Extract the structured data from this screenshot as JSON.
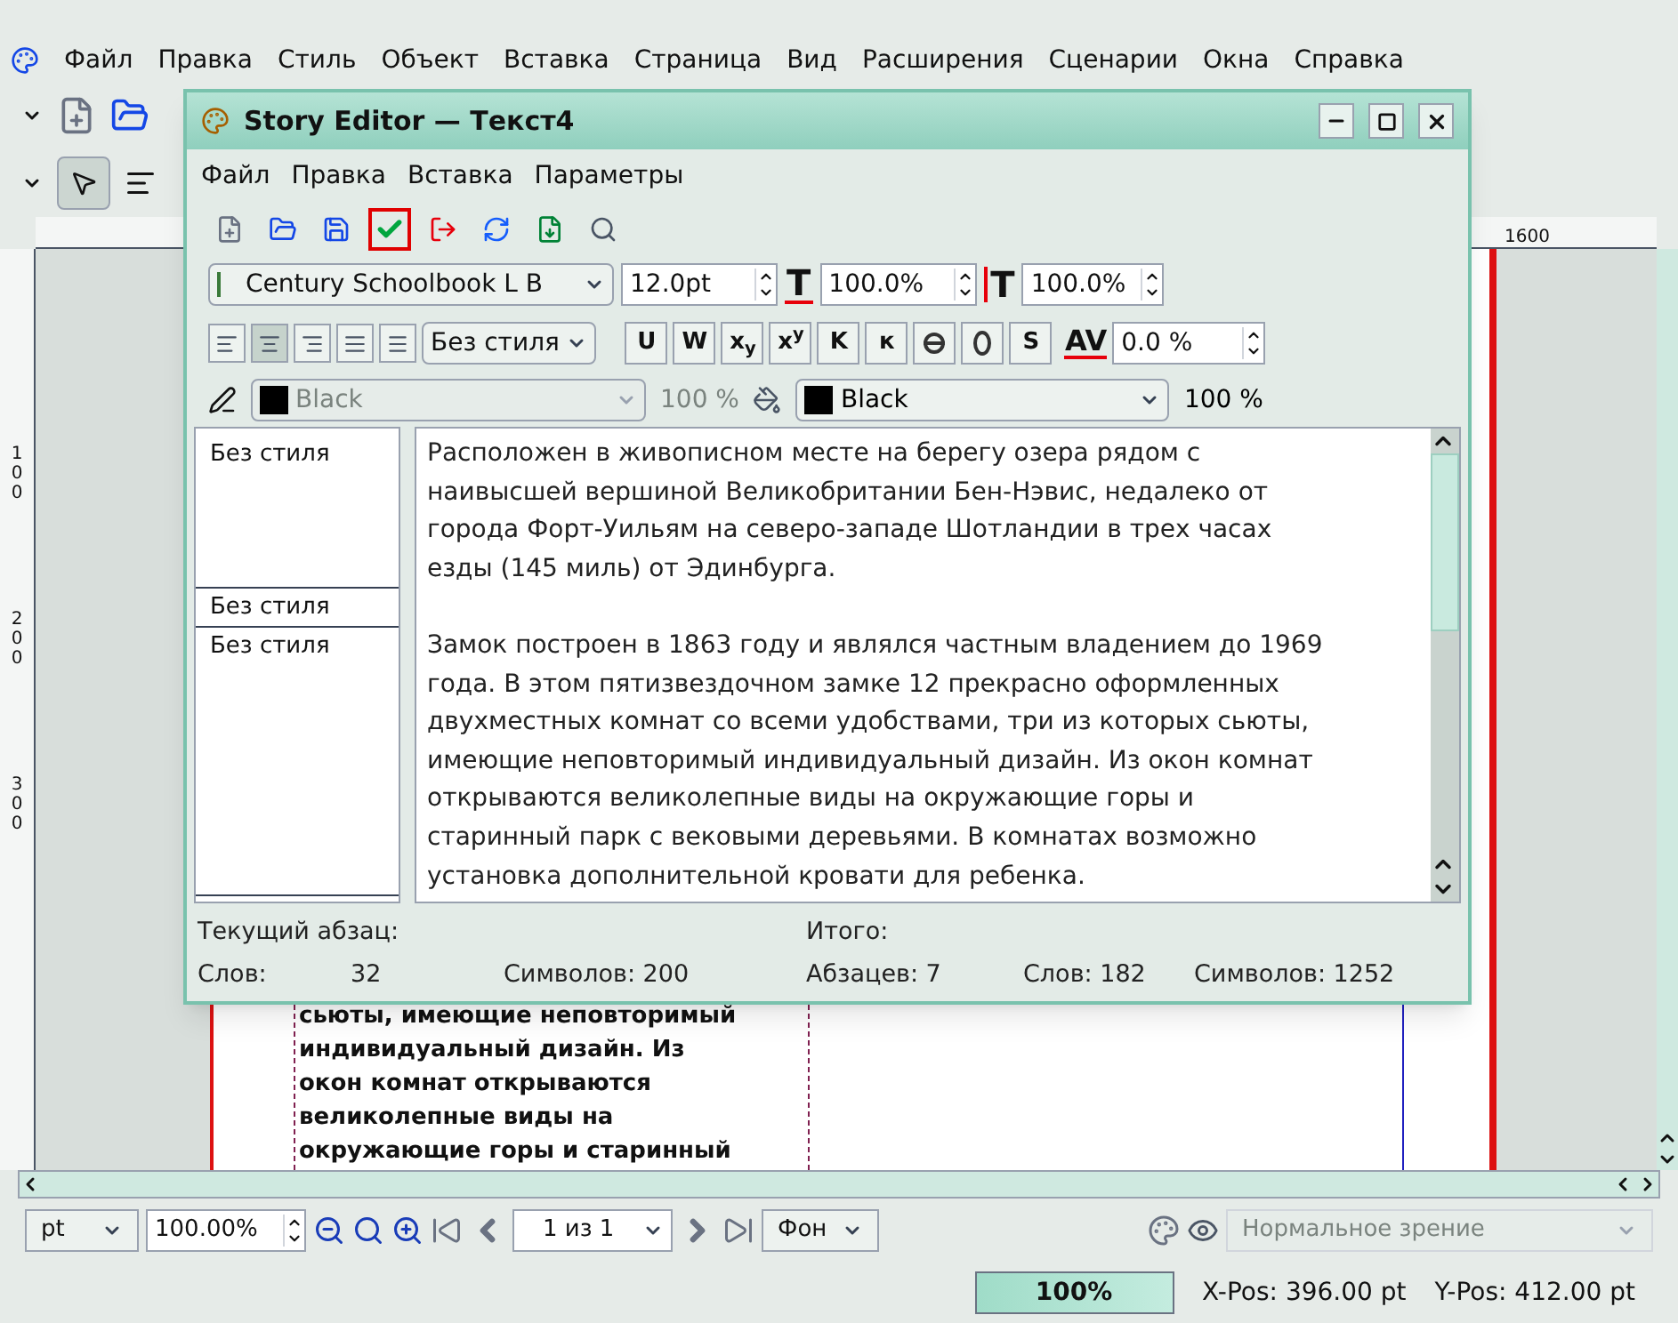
{
  "menubar": {
    "items": [
      "Файл",
      "Правка",
      "Стиль",
      "Объект",
      "Вставка",
      "Страница",
      "Вид",
      "Расширения",
      "Сценарии",
      "Окна",
      "Справка"
    ]
  },
  "ruler": {
    "top_label": "1600",
    "left_labels": [
      "100",
      "200",
      "300"
    ]
  },
  "page_text": [
    "сьюты, имеющие неповторимый",
    "индивидуальный дизайн. Из",
    "окон комнат открываются",
    "великолепные виды на",
    "окружающие горы и старинный"
  ],
  "story_editor": {
    "title": "Story Editor — Текст4",
    "menu": [
      "Файл",
      "Правка",
      "Вставка",
      "Параметры"
    ],
    "toolbar": [
      {
        "kind": "new",
        "highlighted": false
      },
      {
        "kind": "open",
        "highlighted": false
      },
      {
        "kind": "save",
        "highlighted": false
      },
      {
        "kind": "apply",
        "highlighted": true
      },
      {
        "kind": "cancel",
        "highlighted": false
      },
      {
        "kind": "reload",
        "highlighted": false
      },
      {
        "kind": "update",
        "highlighted": false
      },
      {
        "kind": "search",
        "highlighted": false
      }
    ],
    "font": "Century Schoolbook L B",
    "font_size": "12.0pt",
    "scale_h": {
      "icon": "T",
      "value": "100.0%"
    },
    "scale_v": {
      "icon": "T",
      "value": "100.0%"
    },
    "alignment": [
      {
        "selected": false
      },
      {
        "selected": true
      },
      {
        "selected": false
      },
      {
        "selected": false
      },
      {
        "selected": false
      }
    ],
    "paragraph_style": "Без стиля",
    "format_buttons": [
      {
        "kind": "text",
        "label": "U"
      },
      {
        "kind": "text",
        "label": "W"
      },
      {
        "kind": "text",
        "label": "x$_{y}$"
      },
      {
        "kind": "text",
        "label": "x$^{y}$"
      },
      {
        "kind": "text",
        "label": "K"
      },
      {
        "kind": "text",
        "label": "к"
      },
      {
        "kind": "strike"
      },
      {
        "kind": "outline"
      },
      {
        "kind": "text",
        "label": "S"
      }
    ],
    "tracking": {
      "icon": "AV",
      "value": "0.0 %"
    },
    "stroke": {
      "name": "Black",
      "color": "#000000",
      "shade": "100 %",
      "disabled": true
    },
    "fill": {
      "name": "Black",
      "color": "#000000",
      "shade": "100 %",
      "disabled": false
    },
    "styles": [
      {
        "label": "Без стиля"
      },
      {
        "label": "Без стиля"
      },
      {
        "label": "Без стиля"
      }
    ],
    "paragraphs": [
      {
        "lines": [
          "Расположен в живописном месте на берегу озера рядом с",
          "наивысшей вершиной Великобритании Бен-Нэвис, недалеко от",
          "города Форт-Уильям на северо-западе Шотландии в трех часах",
          "езды (145 миль) от Эдинбурга."
        ]
      },
      {
        "lines": [
          "Замок построен в 1863 году и являлся частным владением до 1969",
          "года. В этом пятизвездочном замке 12 прекрасно оформленных",
          "двухместных комнат со всеми удобствами, три из которых сьюты,",
          "имеющие неповторимый индивидуальный дизайн. Из окон комнат",
          "открываются великолепные виды на окружающие горы и",
          "старинный парк с вековыми деревьями. В комнатах возможно",
          "установка дополнительной кровати для ребенка."
        ]
      }
    ],
    "current": {
      "label": "Текущий абзац:",
      "words_label": "Слов:",
      "words": "32",
      "chars": "Символов: 200"
    },
    "total": {
      "label": "Итого:",
      "paragraphs": "Абзацев: 7",
      "words": "Слов: 182",
      "chars": "Символов: 1252"
    }
  },
  "bottom_toolbar": {
    "unit": "pt",
    "zoom": "100.00%",
    "page": "1 из 1",
    "layer": "Фон",
    "view_mode": "Нормальное зрение",
    "view_disabled": true
  },
  "status_bar": {
    "progress": {
      "text": "100%",
      "level": 1
    },
    "x_pos": "X-Pos: 396.00 pt",
    "y_pos": "Y-Pos: 412.00 pt"
  }
}
